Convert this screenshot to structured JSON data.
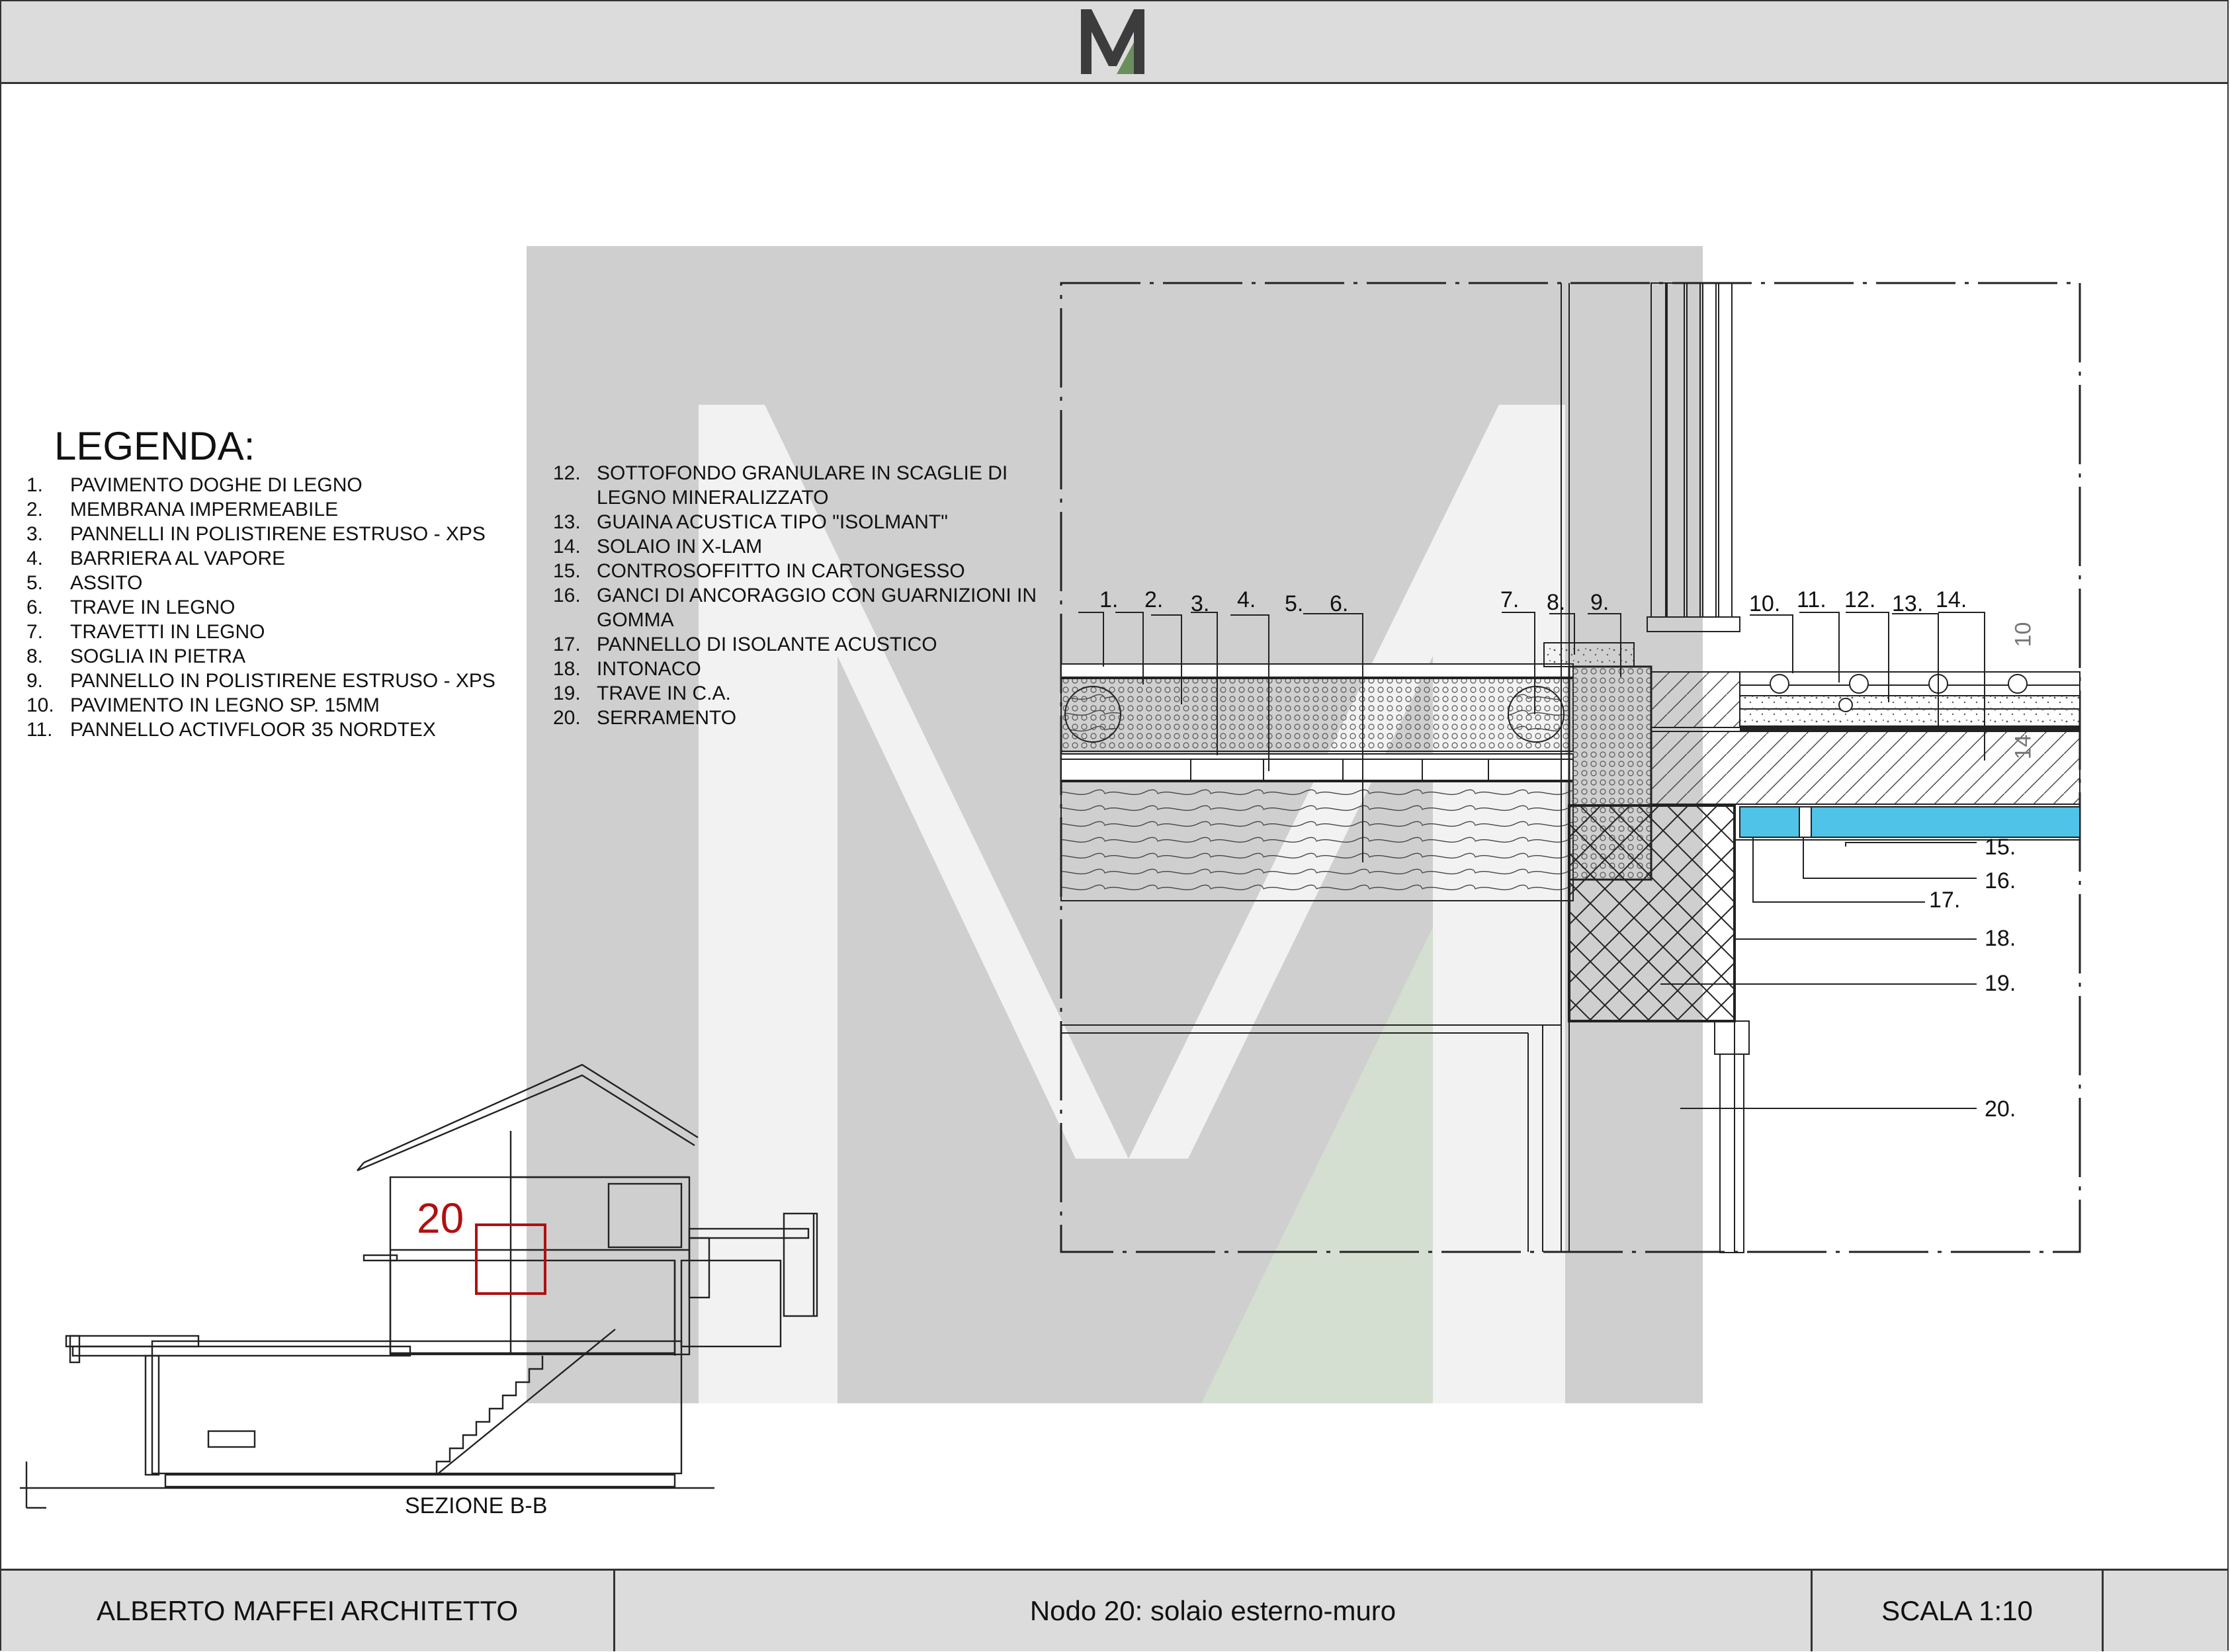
{
  "header": {
    "logo_letter": "M"
  },
  "legend": {
    "title": "LEGENDA:",
    "items": [
      {
        "num": "1.",
        "text": "PAVIMENTO DOGHE DI LEGNO"
      },
      {
        "num": "2.",
        "text": "MEMBRANA IMPERMEABILE"
      },
      {
        "num": "3.",
        "text": "PANNELLI IN POLISTIRENE ESTRUSO - XPS"
      },
      {
        "num": "4.",
        "text": "BARRIERA AL VAPORE"
      },
      {
        "num": "5.",
        "text": "ASSITO"
      },
      {
        "num": "6.",
        "text": "TRAVE IN LEGNO"
      },
      {
        "num": "7.",
        "text": "TRAVETTI IN LEGNO"
      },
      {
        "num": "8.",
        "text": "SOGLIA IN PIETRA"
      },
      {
        "num": "9.",
        "text": "PANNELLO IN POLISTIRENE ESTRUSO - XPS"
      },
      {
        "num": "10.",
        "text": "PAVIMENTO IN LEGNO SP. 15MM"
      },
      {
        "num": "11.",
        "text": "PANNELLO ACTIVFLOOR 35  NORDTEX"
      },
      {
        "num": "12.",
        "text": "SOTTOFONDO GRANULARE IN SCAGLIE DI LEGNO MINERALIZZATO"
      },
      {
        "num": "13.",
        "text": "GUAINA ACUSTICA TIPO \"ISOLMANT\""
      },
      {
        "num": "14.",
        "text": "SOLAIO IN X-LAM"
      },
      {
        "num": "15.",
        "text": "CONTROSOFFITTO IN CARTONGESSO"
      },
      {
        "num": "16.",
        "text": "GANCI  DI ANCORAGGIO CON GUARNIZIONI IN GOMMA"
      },
      {
        "num": "17.",
        "text": "PANNELLO DI ISOLANTE ACUSTICO"
      },
      {
        "num": "18.",
        "text": "INTONACO"
      },
      {
        "num": "19.",
        "text": "TRAVE IN C.A."
      },
      {
        "num": "20.",
        "text": "SERRAMENTO"
      }
    ]
  },
  "detail": {
    "top_labels": [
      "1.",
      "2.",
      "3.",
      "4.",
      "5.",
      "6.",
      "7.",
      "8.",
      "9.",
      "10.",
      "11.",
      "12.",
      "13.",
      "14."
    ],
    "right_labels": [
      "15.",
      "16.",
      "17.",
      "18.",
      "19.",
      "20."
    ],
    "dim_10": "10",
    "dim_14": "14"
  },
  "section": {
    "title": "SEZIONE B-B",
    "node_number": "20"
  },
  "footer": {
    "architect": "ALBERTO MAFFEI ARCHITETTO",
    "drawing_title": "Nodo 20: solaio esterno-muro",
    "scale": "SCALA 1:10"
  },
  "colors": {
    "watermark_grey": "#cfcfcf",
    "watermark_green": "#d4dfd1",
    "insulation_blue": "#4fc3e8",
    "accent_red": "#b01010",
    "band_grey": "#dcdcdc"
  }
}
